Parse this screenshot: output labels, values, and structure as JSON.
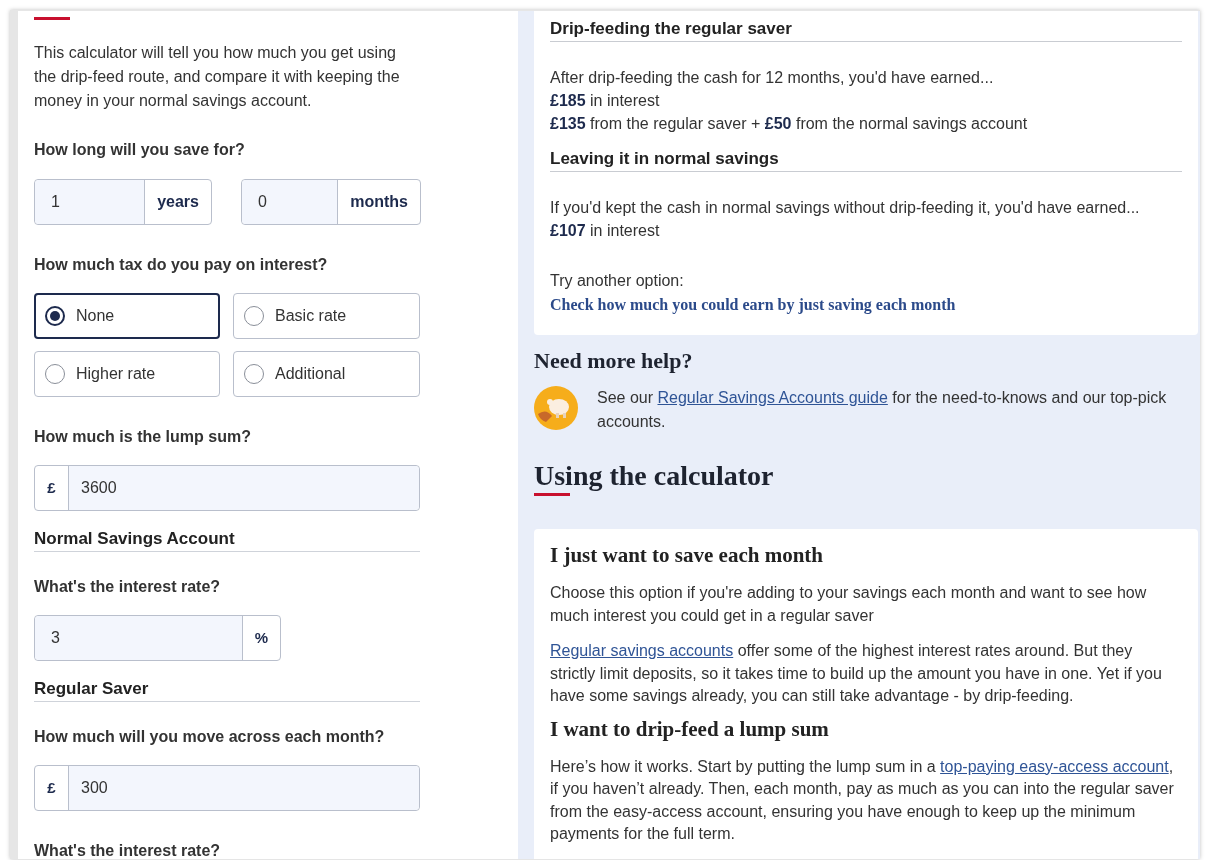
{
  "calculator": {
    "intro": "This calculator will tell you how much you get using the drip-feed route, and compare it with keeping the money in your normal savings account.",
    "items": [
      {
        "kind": "question",
        "text": "How long will you save for?"
      },
      {
        "kind": "duration",
        "fields": [
          {
            "value": "1",
            "unit": "years"
          },
          {
            "value": "0",
            "unit": "months"
          }
        ]
      },
      {
        "kind": "question",
        "text": "How much tax do you pay on interest?"
      },
      {
        "kind": "radio_group",
        "options": [
          {
            "label": "None",
            "selected": true
          },
          {
            "label": "Basic rate",
            "selected": false
          },
          {
            "label": "Higher rate",
            "selected": false
          },
          {
            "label": "Additional",
            "selected": false
          }
        ]
      },
      {
        "kind": "question",
        "text": "How much is the lump sum?"
      },
      {
        "kind": "prefixed_field",
        "prefix": "£",
        "value": "3600"
      },
      {
        "kind": "section_heading",
        "text": "Normal Savings Account"
      },
      {
        "kind": "question",
        "text": "What's the interest rate?"
      },
      {
        "kind": "suffixed_field",
        "suffix": "%",
        "value": "3"
      },
      {
        "kind": "section_heading",
        "text": "Regular Saver"
      },
      {
        "kind": "question",
        "text": "How much will you move across each month?"
      },
      {
        "kind": "prefixed_field",
        "prefix": "£",
        "value": "300"
      },
      {
        "kind": "question",
        "text": "What's the interest rate?"
      }
    ]
  },
  "results": {
    "sections": [
      {
        "heading": "Drip-feeding the regular saver",
        "lines": [
          "After drip-feeding the cash for 12 months, you'd have earned...",
          "**£185** in interest",
          "**£135** from the regular saver + **£50** from the normal savings account"
        ]
      },
      {
        "heading": "Leaving it in normal savings",
        "lines": [
          "If you'd kept the cash in normal savings without drip-feeding it, you'd have earned...",
          "**£107** in interest"
        ]
      }
    ],
    "try_label": "Try another option:",
    "try_link": "Check how much you could earn by just saving each month"
  },
  "help": {
    "title": "Need more help?",
    "parts": [
      {
        "kind": "text",
        "text": "See our "
      },
      {
        "kind": "link",
        "text": "Regular Savings Accounts guide"
      },
      {
        "kind": "text",
        "text": " for the need-to-knows and our top-pick accounts."
      }
    ]
  },
  "using": {
    "title": "Using the calculator",
    "blocks": [
      {
        "kind": "heading",
        "text": "I just want to save each month"
      },
      {
        "kind": "paragraph",
        "parts": [
          {
            "kind": "text",
            "text": "Choose this option if you're adding to your savings each month and want to see how much interest you could get in a regular saver"
          }
        ]
      },
      {
        "kind": "paragraph",
        "parts": [
          {
            "kind": "link",
            "text": "Regular savings accounts"
          },
          {
            "kind": "text",
            "text": " offer some of the highest interest rates around. But they strictly limit deposits, so it takes time to build up the amount you have in one. Yet if you have some savings already, you can still take advantage - by drip-feeding."
          }
        ]
      },
      {
        "kind": "heading",
        "text": "I want to drip-feed a lump sum"
      },
      {
        "kind": "paragraph",
        "parts": [
          {
            "kind": "text",
            "text": "Here’s how it works. Start by putting the lump sum in a "
          },
          {
            "kind": "link",
            "text": "top-paying easy-access account"
          },
          {
            "kind": "text",
            "text": ", if you haven’t already. Then, each month, pay as much as you can into the regular saver from the easy-access account, ensuring you have enough to keep up the minimum payments for the full term."
          }
        ]
      }
    ]
  }
}
